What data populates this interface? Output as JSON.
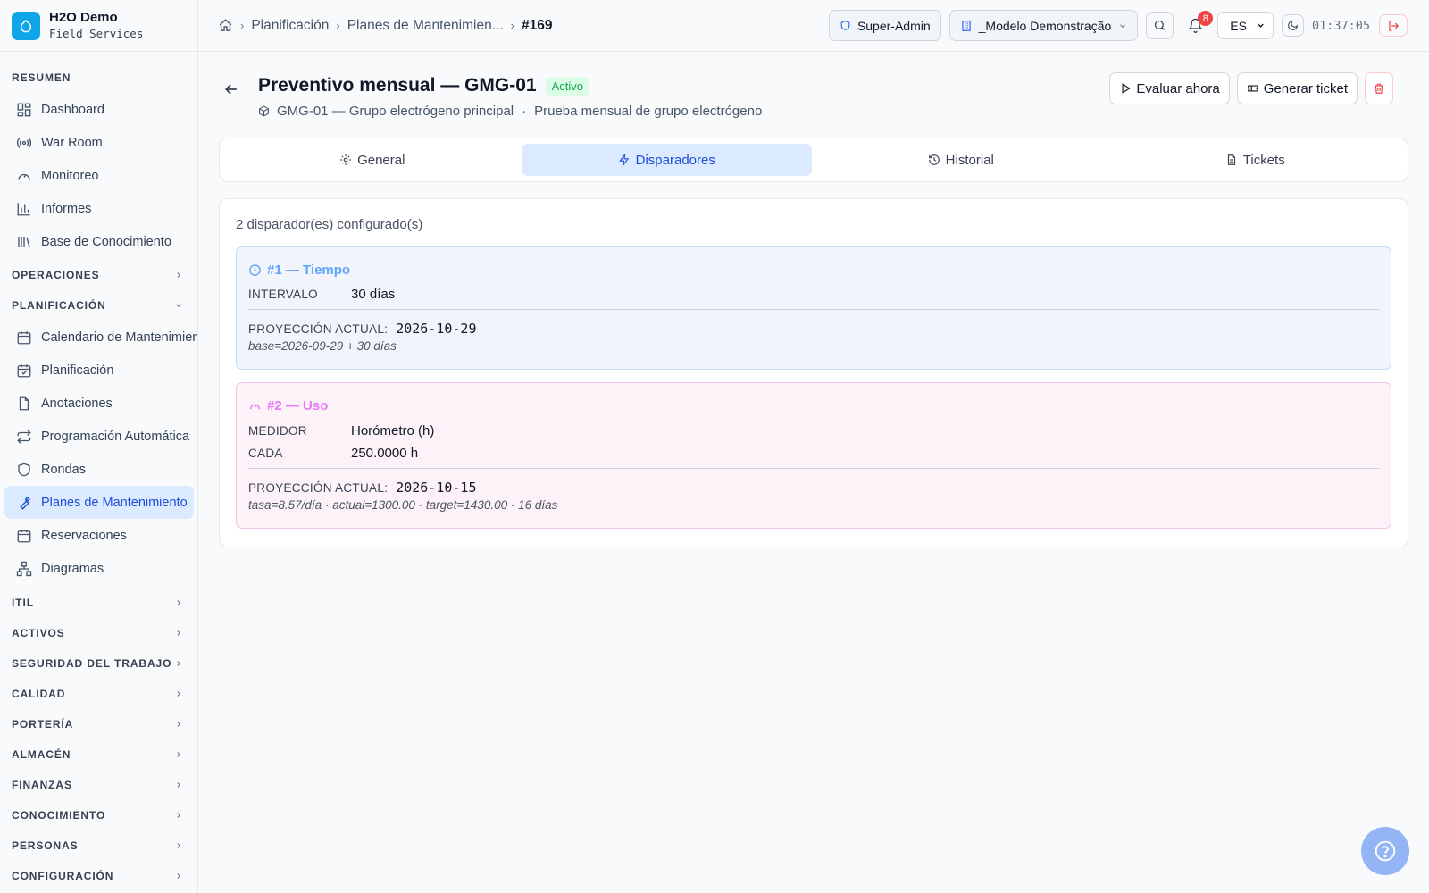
{
  "brand": {
    "name": "H2O Demo",
    "subtitle": "Field Services"
  },
  "sidebar": {
    "sections": [
      {
        "id": "resumen",
        "label": "RESUMEN",
        "items": [
          {
            "label": "Dashboard",
            "icon": "dashboard-icon"
          },
          {
            "label": "War Room",
            "icon": "broadcast-icon"
          },
          {
            "label": "Monitoreo",
            "icon": "gauge-icon"
          },
          {
            "label": "Informes",
            "icon": "bar-chart-icon"
          },
          {
            "label": "Base de Conocimiento",
            "icon": "library-icon"
          }
        ]
      },
      {
        "id": "operaciones",
        "label": "OPERACIONES"
      },
      {
        "id": "planificacion",
        "label": "PLANIFICACIÓN",
        "items": [
          {
            "label": "Calendario de Mantenimiento",
            "icon": "calendar-icon"
          },
          {
            "label": "Planificación",
            "icon": "calendar-check-icon"
          },
          {
            "label": "Anotaciones",
            "icon": "file-icon"
          },
          {
            "label": "Programación Automática",
            "icon": "repeat-icon"
          },
          {
            "label": "Rondas",
            "icon": "shield-icon"
          },
          {
            "label": "Planes de Mantenimiento",
            "icon": "wrench-icon",
            "active": true
          },
          {
            "label": "Reservaciones",
            "icon": "calendar-icon"
          },
          {
            "label": "Diagramas",
            "icon": "diagram-icon"
          }
        ]
      },
      {
        "id": "itil",
        "label": "ITIL"
      },
      {
        "id": "activos",
        "label": "ACTIVOS"
      },
      {
        "id": "seguridad",
        "label": "SEGURIDAD DEL TRABAJO"
      },
      {
        "id": "calidad",
        "label": "CALIDAD"
      },
      {
        "id": "porteria",
        "label": "PORTERÍA"
      },
      {
        "id": "almacen",
        "label": "ALMACÉN"
      },
      {
        "id": "finanzas",
        "label": "FINANZAS"
      },
      {
        "id": "conocimiento",
        "label": "CONOCIMIENTO"
      },
      {
        "id": "personas",
        "label": "PERSONAS"
      },
      {
        "id": "configuracion",
        "label": "CONFIGURACIÓN"
      }
    ]
  },
  "header": {
    "breadcrumbs": [
      "Planificación",
      "Planes de Mantenimien...",
      "#169"
    ],
    "role": "Super-Admin",
    "tenant": "_Modelo Demonstração",
    "notifications": "8",
    "language": "ES",
    "clock": "01:37:05"
  },
  "page": {
    "title": "Preventivo mensual — GMG-01",
    "status": "Activo",
    "asset": "GMG-01 — Grupo electrógeno principal",
    "separator": "·",
    "description": "Prueba mensual de grupo electrógeno",
    "evaluate_label": "Evaluar ahora",
    "ticket_label": "Generar ticket"
  },
  "tabs": [
    {
      "label": "General",
      "icon": "gear-icon"
    },
    {
      "label": "Disparadores",
      "icon": "zap-icon",
      "active": true
    },
    {
      "label": "Historial",
      "icon": "history-icon"
    },
    {
      "label": "Tickets",
      "icon": "document-icon"
    }
  ],
  "triggers": {
    "count_text": "2 disparador(es) configurado(s)",
    "time": {
      "title": "#1 — Tiempo",
      "interval_label": "INTERVALO",
      "interval_value": "30 días",
      "projection_label": "PROYECCIÓN ACTUAL:",
      "projection_value": "2026-10-29",
      "note": "base=2026-09-29 + 30 días"
    },
    "usage": {
      "title": "#2 — Uso",
      "meter_label": "MEDIDOR",
      "meter_value": "Horómetro (h)",
      "every_label": "CADA",
      "every_value": "250.0000 h",
      "projection_label": "PROYECCIÓN ACTUAL:",
      "projection_value": "2026-10-15",
      "note": "tasa=8.57/día · actual=1300.00 · target=1430.00 · 16 días"
    }
  },
  "colors": {
    "accent": "#1d4ed8",
    "active_bg": "#dbeafe",
    "status_green": "#16a34a",
    "danger": "#ef4444",
    "time_accent": "#60a5fa",
    "usage_accent": "#e879f9"
  }
}
